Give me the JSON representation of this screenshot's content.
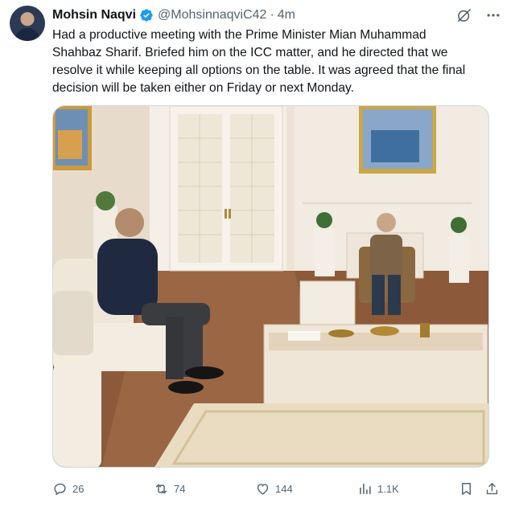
{
  "tweet": {
    "author_name": "Mohsin Naqvi",
    "handle": "@MohsinnaqviC42",
    "separator": "·",
    "time": "4m",
    "text": "Had a productive meeting with the Prime Minister Mian Muhammad\nShahbaz Sharif. Briefed him on the ICC matter, and he directed that we\nresolve it while keeping all options on the table. It was agreed that the final\ndecision will be taken either on Friday or next Monday."
  },
  "actions": {
    "replies": "26",
    "reposts": "74",
    "likes": "144",
    "views": "1.1K"
  },
  "colors": {
    "verified": "#1d9bf0",
    "text": "#0f1419",
    "muted": "#536471"
  }
}
